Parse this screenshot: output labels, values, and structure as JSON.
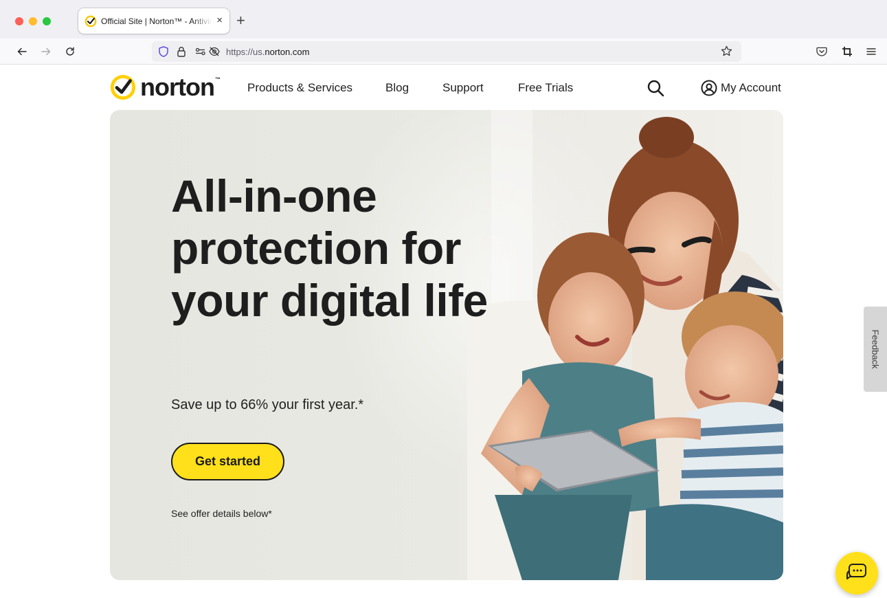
{
  "browser": {
    "tab_title": "Official Site | Norton™ - Antivirus & Anti-Malware",
    "tab_close": "×",
    "new_tab": "+",
    "url_prefix": "https://us.",
    "url_domain": "norton.com"
  },
  "icons": {
    "back": "arrow-left-icon",
    "forward": "arrow-right-icon",
    "reload": "reload-icon",
    "shield": "shield-icon",
    "lock": "lock-icon",
    "permissions": "permissions-icon",
    "tracking": "tracking-protection-icon",
    "bookmark": "star-icon",
    "pocket": "pocket-icon",
    "extensions": "crop-icon",
    "menu": "hamburger-menu-icon",
    "search": "search-icon",
    "account": "account-icon",
    "chat": "chat-bubble-icon"
  },
  "colors": {
    "brand_yellow": "#ffe01b",
    "text_dark": "#1e1e1e"
  },
  "header": {
    "logo_text": "norton",
    "logo_tm": "™",
    "nav": [
      {
        "label": "Products & Services"
      },
      {
        "label": "Blog"
      },
      {
        "label": "Support"
      },
      {
        "label": "Free Trials"
      }
    ],
    "account_label": "My Account"
  },
  "hero": {
    "title": "All-in-one protection for your digital life",
    "subtitle": "Save up to 66% your first year.*",
    "cta_label": "Get started",
    "note": "See offer details below*"
  },
  "feedback_label": "Feedback"
}
